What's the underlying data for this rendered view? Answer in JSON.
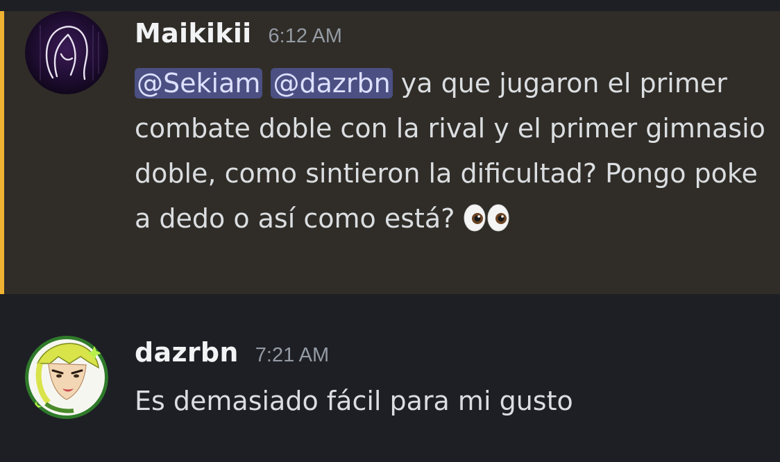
{
  "messages": [
    {
      "username": "Maikikii",
      "timestamp": "6:12 AM",
      "mentions": [
        "@Sekiam",
        "@dazrbn"
      ],
      "text": " ya que jugaron el primer combate doble con la rival y el primer gimnasio doble, como sintieron la dificultad? Pongo poke a dedo o así como está? ",
      "emoji": "eyes-emoji",
      "highlighted": true,
      "highlight_color": "#f0b232"
    },
    {
      "username": "dazrbn",
      "timestamp": "7:21 AM",
      "text": "Es demasiado fácil para mi gusto",
      "highlighted": false
    }
  ],
  "colors": {
    "background": "#1e1f25",
    "highlight_background": "#302d28",
    "mention_background": "#4b4f82",
    "text": "#dbdee1",
    "username": "#f2f3f5",
    "timestamp": "#949ba4"
  }
}
